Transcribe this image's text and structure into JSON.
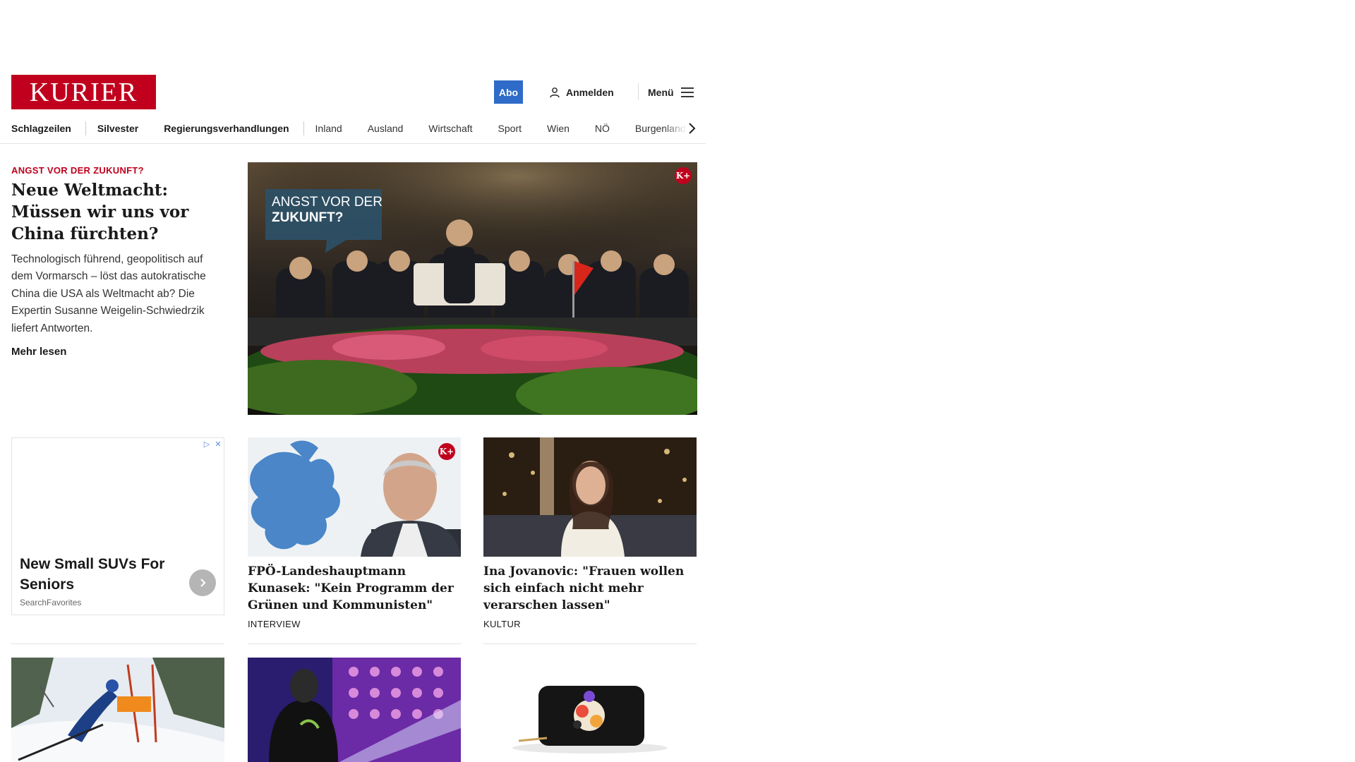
{
  "header": {
    "logo_text": "KURIER",
    "abo_label": "Abo",
    "login_label": "Anmelden",
    "menu_label": "Menü"
  },
  "nav": {
    "items": [
      "Schlagzeilen",
      "Silvester",
      "Regierungsverhandlungen",
      "Inland",
      "Ausland",
      "Wirtschaft",
      "Sport",
      "Wien",
      "NÖ",
      "Burgenland"
    ]
  },
  "lead": {
    "kicker": "ANGST VOR DER ZUKUNFT?",
    "title": "Neue Weltmacht: Müssen wir uns vor China fürchten?",
    "text": "Technologisch führend, geopolitisch auf dem Vormarsch – löst das autokratische China die USA als Weltmacht ab? Die Expertin Susanne Weigelin-Schwiedrzik liefert Antworten.",
    "more_label": "Mehr lesen",
    "image_overlay_line1": "ANGST VOR DER",
    "image_overlay_line2": "ZUKUNFT?",
    "badge": "K+"
  },
  "ad": {
    "title": "New Small SUVs For Seniors",
    "source": "SearchFavorites"
  },
  "cards": [
    {
      "title": "FPÖ-Landeshauptmann Kunasek: \"Kein Programm der Grünen und Kommunisten\"",
      "section": "INTERVIEW",
      "badge": "K+"
    },
    {
      "title": "Ina Jovanovic: \"Frauen wollen sich einfach nicht mehr verarschen lassen\"",
      "section": "KULTUR"
    }
  ],
  "colors": {
    "brand_red": "#c0001d",
    "abo_blue": "#2f6bc8"
  }
}
